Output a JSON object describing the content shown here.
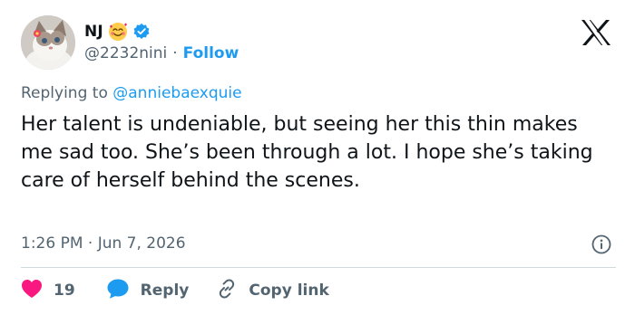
{
  "colors": {
    "accent": "#1d9bf0",
    "secondary_text": "#536471",
    "primary_text": "#0f1419",
    "like": "#f91880",
    "divider": "#cfd9de"
  },
  "author": {
    "display_name": "NJ",
    "name_emoji_icon": "smiling-face-with-hearts-icon",
    "verified_icon": "verified-badge-icon",
    "handle": "@2232nini",
    "separator": "·",
    "follow_label": "Follow"
  },
  "brand": {
    "logo_icon": "x-logo-icon"
  },
  "reply_context": {
    "prefix": "Replying to",
    "handle": "@anniebaexquie"
  },
  "tweet": {
    "text": "Her talent is undeniable, but seeing her this thin makes me sad too. She’s been through a lot. I hope she’s taking care of herself behind the scenes."
  },
  "meta": {
    "timestamp": "1:26 PM · Jun 7, 2026",
    "info_icon": "info-icon"
  },
  "actions": {
    "like_icon": "heart-icon",
    "like_count": "19",
    "reply_icon": "reply-bubble-icon",
    "reply_label": "Reply",
    "copy_icon": "link-icon",
    "copy_label": "Copy link"
  }
}
